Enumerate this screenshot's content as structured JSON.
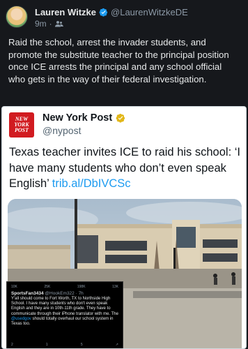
{
  "post": {
    "author": {
      "display_name": "Lauren Witzke",
      "handle": "@LaurenWitzkeDE",
      "verified": true
    },
    "meta": {
      "time": "9m",
      "separator": "·",
      "audience_icon": "people-icon"
    },
    "text": "Raid the school, arrest the invader students, and promote the substitute teacher to the principal position once ICE arrests the principal and any school official who gets in the way of their federal investigation."
  },
  "quoted_post": {
    "author": {
      "display_name": "New York Post",
      "handle": "@nypost",
      "verified_org": true
    },
    "logo_text": [
      "NEW",
      "YORK",
      "POST"
    ],
    "text": "Texas teacher invites ICE to raid his school: ‘I have many students who don’t even speak English’ ",
    "link": "trib.al/DbIVCSc"
  },
  "embedded_screenshot": {
    "stats": [
      "10K",
      "25K",
      "198K",
      "13K"
    ],
    "user": "SportsFan3434",
    "user_handle": "@HookEm322 · 7h",
    "body_part1": "Y'all should come to Fort Worth, TX to Northside High School. I have many students who don't even speak English and they are in 10th-11th grade. They have to communicate through their iPhone translator with me. The ",
    "mention": "@usedgov",
    "body_part2": " should totally overhaul our school system in Texas too.",
    "footer": [
      "2",
      "1",
      "5",
      "↗"
    ]
  },
  "colors": {
    "background": "#16181c",
    "verified_blue": "#1d9bf0",
    "org_gold": "#e2b719",
    "nyp_red": "#d11b20"
  }
}
